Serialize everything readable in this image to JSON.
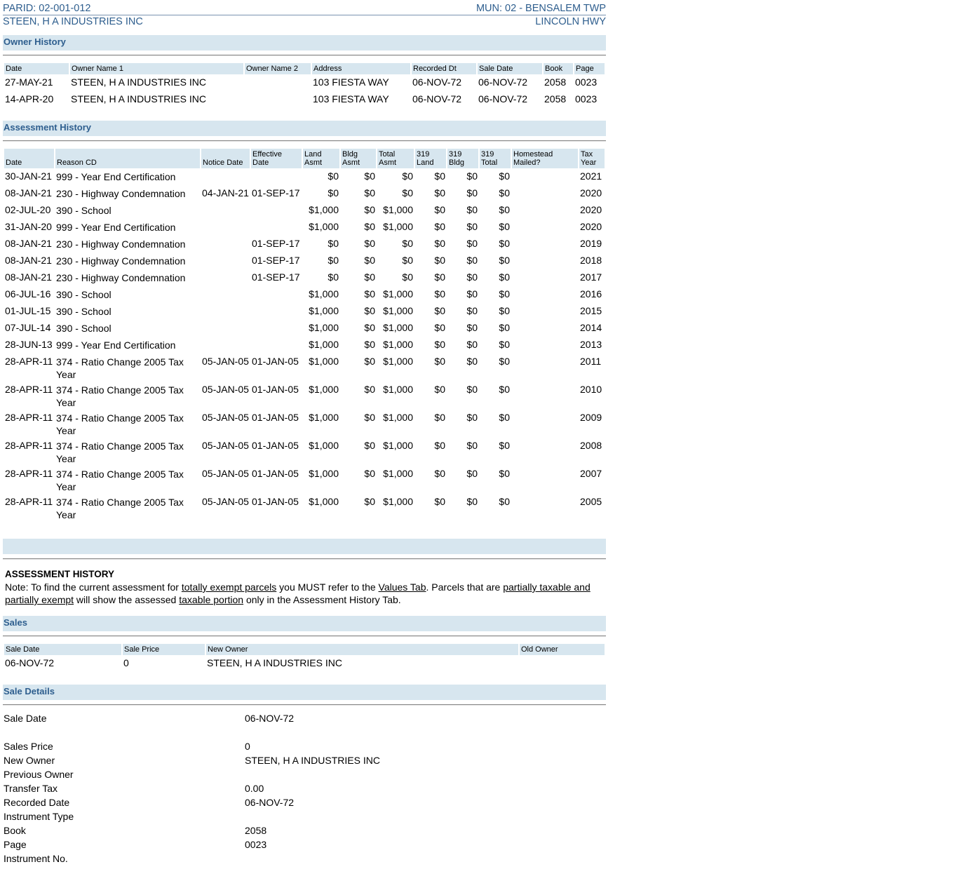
{
  "header": {
    "parid": "PARID: 02-001-012",
    "owner": "STEEN, H A INDUSTRIES INC",
    "mun": "MUN: 02 - BENSALEM TWP",
    "street": "LINCOLN HWY"
  },
  "owner_history": {
    "title": "Owner History",
    "columns": [
      "Date",
      "Owner Name 1",
      "Owner Name 2",
      "Address",
      "Recorded Dt",
      "Sale Date",
      "Book",
      "Page"
    ],
    "rows": [
      [
        "27-MAY-21",
        "STEEN, H A INDUSTRIES INC",
        "",
        "103 FIESTA WAY",
        "06-NOV-72",
        "06-NOV-72",
        "2058",
        "0023"
      ],
      [
        "14-APR-20",
        "STEEN, H A INDUSTRIES INC",
        "",
        "103 FIESTA WAY",
        "06-NOV-72",
        "06-NOV-72",
        "2058",
        "0023"
      ]
    ]
  },
  "assessment_history": {
    "title": "Assessment History",
    "columns": {
      "date": "Date",
      "reason": "Reason CD",
      "notice": "Notice Date",
      "effective": "Effective Date",
      "land_a": "Land",
      "land_b": "Asmt",
      "bldg_a": "Bldg",
      "bldg_b": "Asmt",
      "total_a": "Total",
      "total_b": "Asmt",
      "l319_a": "319",
      "l319_b": "Land",
      "b319_a": "319",
      "b319_b": "Bldg",
      "t319_a": "319",
      "t319_b": "Total",
      "home_a": "Homestead",
      "home_b": "Mailed?",
      "tax_a": "Tax",
      "tax_b": "Year"
    },
    "rows": [
      [
        "30-JAN-21",
        "999 - Year End Certification",
        "",
        "",
        "$0",
        "$0",
        "$0",
        "$0",
        "$0",
        "$0",
        "",
        "2021"
      ],
      [
        "08-JAN-21",
        "230 - Highway Condemnation",
        "04-JAN-21",
        "01-SEP-17",
        "$0",
        "$0",
        "$0",
        "$0",
        "$0",
        "$0",
        "",
        "2020"
      ],
      [
        "02-JUL-20",
        "390 - School",
        "",
        "",
        "$1,000",
        "$0",
        "$1,000",
        "$0",
        "$0",
        "$0",
        "",
        "2020"
      ],
      [
        "31-JAN-20",
        "999 - Year End Certification",
        "",
        "",
        "$1,000",
        "$0",
        "$1,000",
        "$0",
        "$0",
        "$0",
        "",
        "2020"
      ],
      [
        "08-JAN-21",
        "230 - Highway Condemnation",
        "",
        "01-SEP-17",
        "$0",
        "$0",
        "$0",
        "$0",
        "$0",
        "$0",
        "",
        "2019"
      ],
      [
        "08-JAN-21",
        "230 - Highway Condemnation",
        "",
        "01-SEP-17",
        "$0",
        "$0",
        "$0",
        "$0",
        "$0",
        "$0",
        "",
        "2018"
      ],
      [
        "08-JAN-21",
        "230 - Highway Condemnation",
        "",
        "01-SEP-17",
        "$0",
        "$0",
        "$0",
        "$0",
        "$0",
        "$0",
        "",
        "2017"
      ],
      [
        "06-JUL-16",
        "390 - School",
        "",
        "",
        "$1,000",
        "$0",
        "$1,000",
        "$0",
        "$0",
        "$0",
        "",
        "2016"
      ],
      [
        "01-JUL-15",
        "390 - School",
        "",
        "",
        "$1,000",
        "$0",
        "$1,000",
        "$0",
        "$0",
        "$0",
        "",
        "2015"
      ],
      [
        "07-JUL-14",
        "390 - School",
        "",
        "",
        "$1,000",
        "$0",
        "$1,000",
        "$0",
        "$0",
        "$0",
        "",
        "2014"
      ],
      [
        "28-JUN-13",
        "999 - Year End Certification",
        "",
        "",
        "$1,000",
        "$0",
        "$1,000",
        "$0",
        "$0",
        "$0",
        "",
        "2013"
      ],
      [
        "28-APR-11",
        "374 - Ratio Change 2005 Tax Year",
        "05-JAN-05",
        "01-JAN-05",
        "$1,000",
        "$0",
        "$1,000",
        "$0",
        "$0",
        "$0",
        "",
        "2011"
      ],
      [
        "28-APR-11",
        "374 - Ratio Change 2005 Tax Year",
        "05-JAN-05",
        "01-JAN-05",
        "$1,000",
        "$0",
        "$1,000",
        "$0",
        "$0",
        "$0",
        "",
        "2010"
      ],
      [
        "28-APR-11",
        "374 - Ratio Change 2005 Tax Year",
        "05-JAN-05",
        "01-JAN-05",
        "$1,000",
        "$0",
        "$1,000",
        "$0",
        "$0",
        "$0",
        "",
        "2009"
      ],
      [
        "28-APR-11",
        "374 - Ratio Change 2005 Tax Year",
        "05-JAN-05",
        "01-JAN-05",
        "$1,000",
        "$0",
        "$1,000",
        "$0",
        "$0",
        "$0",
        "",
        "2008"
      ],
      [
        "28-APR-11",
        "374 - Ratio Change 2005 Tax Year",
        "05-JAN-05",
        "01-JAN-05",
        "$1,000",
        "$0",
        "$1,000",
        "$0",
        "$0",
        "$0",
        "",
        "2007"
      ],
      [
        "28-APR-11",
        "374 - Ratio Change 2005 Tax Year",
        "05-JAN-05",
        "01-JAN-05",
        "$1,000",
        "$0",
        "$1,000",
        "$0",
        "$0",
        "$0",
        "",
        "2005"
      ]
    ]
  },
  "note": {
    "title": "ASSESSMENT HISTORY",
    "p1": "Note: To find the current assessment for ",
    "link1": "totally exempt parcels",
    "p2": " you MUST refer to the ",
    "link2": "Values Tab",
    "p3": ". Parcels that are ",
    "link3": "partially taxable and partially exempt",
    "p4": " will show the assessed ",
    "link4": "taxable portion",
    "p5": " only in the Assessment History Tab."
  },
  "sales": {
    "title": "Sales",
    "columns": [
      "Sale Date",
      "Sale Price",
      "New Owner",
      "Old Owner"
    ],
    "rows": [
      [
        "06-NOV-72",
        "0",
        "STEEN, H A INDUSTRIES INC",
        ""
      ]
    ]
  },
  "sale_details": {
    "title": "Sale Details",
    "items": [
      {
        "label": "Sale Date",
        "value": "06-NOV-72"
      },
      {
        "label": "Sales Price",
        "value": "0"
      },
      {
        "label": "New Owner",
        "value": "STEEN, H A INDUSTRIES INC"
      },
      {
        "label": "Previous Owner",
        "value": ""
      },
      {
        "label": "Transfer Tax",
        "value": "0.00"
      },
      {
        "label": "Recorded Date",
        "value": "06-NOV-72"
      },
      {
        "label": "Instrument Type",
        "value": ""
      },
      {
        "label": "Book",
        "value": "2058"
      },
      {
        "label": "Page",
        "value": "0023"
      },
      {
        "label": "Instrument No.",
        "value": ""
      }
    ]
  }
}
